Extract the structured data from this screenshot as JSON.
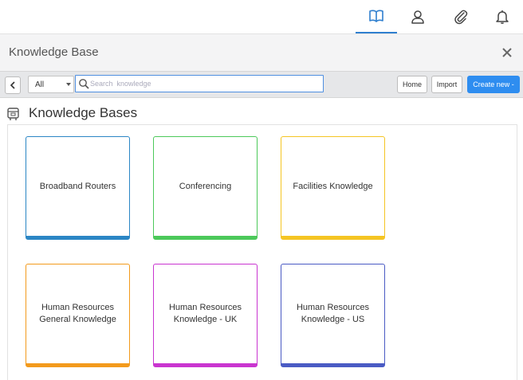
{
  "header": {
    "icons": [
      {
        "name": "book-icon",
        "active": true
      },
      {
        "name": "user-icon",
        "active": false
      },
      {
        "name": "paperclip-icon",
        "active": false
      },
      {
        "name": "bell-icon",
        "active": false
      }
    ]
  },
  "title_bar": {
    "title": "Knowledge Base"
  },
  "toolbar": {
    "filter_value": "All",
    "search_placeholder": "Search  knowledge",
    "home_label": "Home",
    "import_label": "Import",
    "create_label": "Create new -"
  },
  "section": {
    "title": "Knowledge Bases"
  },
  "cards": [
    {
      "label": "Broadband Routers",
      "color": "#2b86c5"
    },
    {
      "label": "Conferencing",
      "color": "#4cc95a"
    },
    {
      "label": "Facilities Knowledge",
      "color": "#f5c523"
    },
    {
      "label": "Human Resources General Knowledge",
      "color": "#f39a1c"
    },
    {
      "label": "Human Resources Knowledge - UK",
      "color": "#c935d0"
    },
    {
      "label": "Human Resources Knowledge - US",
      "color": "#4a5bc4"
    }
  ]
}
